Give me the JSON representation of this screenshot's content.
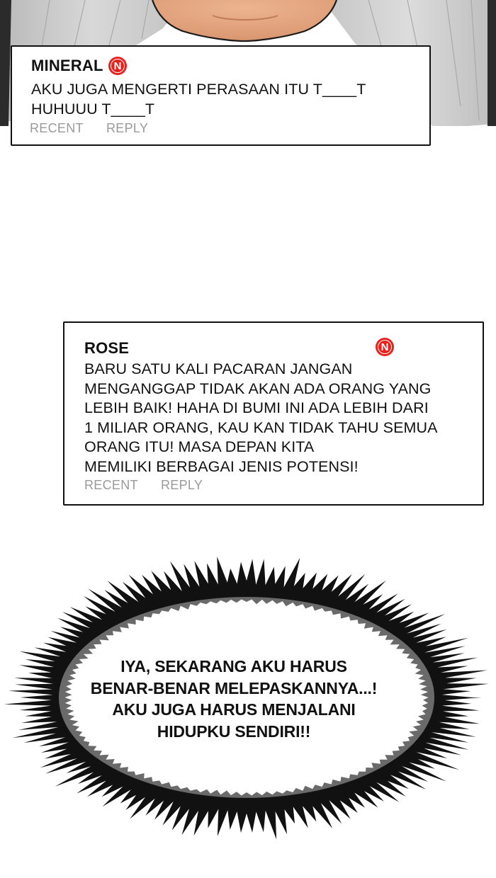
{
  "comments": [
    {
      "username": "MINERAL",
      "badge": "N",
      "text": "AKU JUGA MENGERTI PERASAAN ITU T____T\nHUHUUU T____T",
      "recent_label": "RECENT",
      "reply_label": "REPLY"
    },
    {
      "username": "ROSE",
      "badge": "N",
      "text": "BARU SATU KALI PACARAN JANGAN\nMENGANGGAP TIDAK AKAN ADA ORANG YANG\nLEBIH BAIK! HAHA DI BUMI INI ADA LEBIH DARI\n1 MILIAR ORANG, KAU KAN TIDAK TAHU SEMUA\nORANG ITU! MASA DEPAN KITA\nMEMILIKI BERBAGAI JENIS POTENSI!",
      "recent_label": "RECENT",
      "reply_label": "REPLY"
    }
  ],
  "speech_bubble": {
    "lines": [
      "IYA, SEKARANG AKU HARUS",
      "BENAR-BENAR MELEPASKANNYA...!",
      "AKU JUGA HARUS MENJALANI",
      "HIDUPKU SENDIRI!!"
    ]
  },
  "colors": {
    "badge": "#e8211c",
    "action_text": "#9a9a9a",
    "skin": "#e2a27c",
    "hair": "#c9c9c9"
  }
}
